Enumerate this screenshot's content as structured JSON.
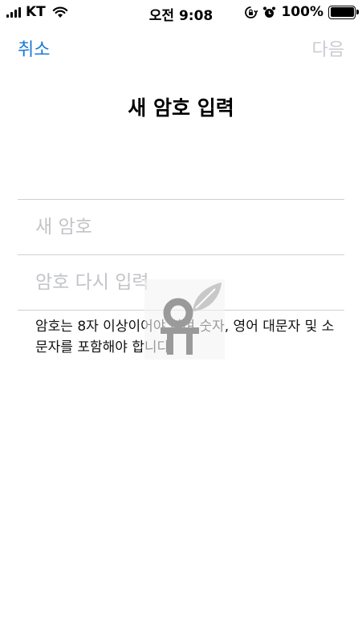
{
  "status_bar": {
    "carrier": "KT",
    "time": "오전 9:08",
    "battery_percent": "100%"
  },
  "nav": {
    "cancel_label": "취소",
    "next_label": "다음"
  },
  "page_title": "새 암호 입력",
  "form": {
    "new_password_placeholder": "새 암호",
    "confirm_password_placeholder": "암호 다시 입력",
    "new_password_value": "",
    "confirm_password_value": ""
  },
  "hint_text": "암호는 8자 이상이어야 하며 숫자, 영어 대문자 및 소문자를 포함해야 합니다.",
  "colors": {
    "accent": "#1a79d6",
    "disabled": "#c9ccd1",
    "placeholder": "#c3c4c8",
    "divider": "#cfcfd3"
  }
}
